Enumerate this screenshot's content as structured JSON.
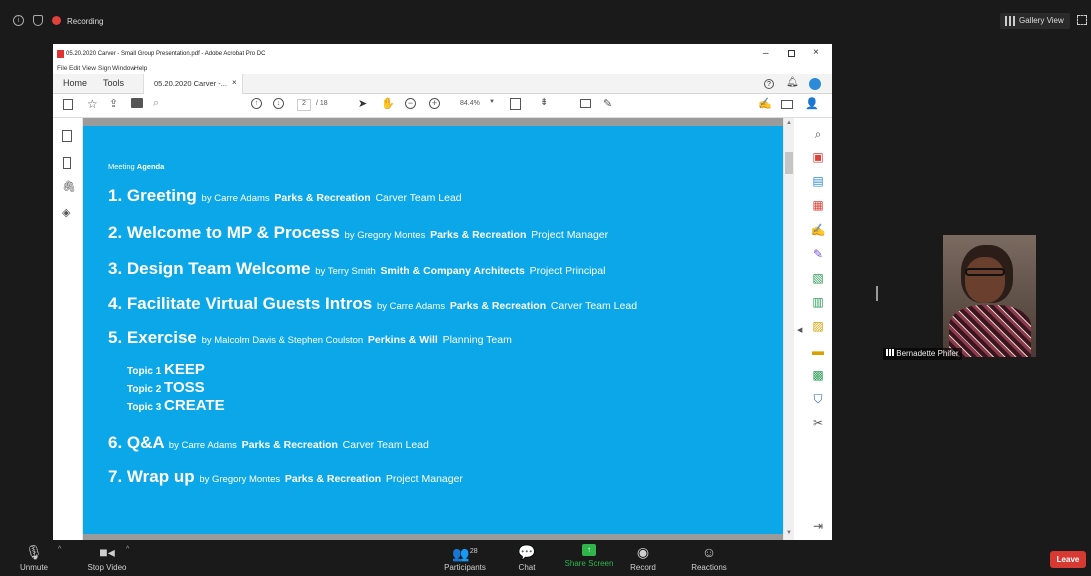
{
  "zoom": {
    "top": {
      "recording_label": "Recording",
      "gallery_view_label": "Gallery View"
    },
    "bottom": {
      "unmute": "Unmute",
      "stop_video": "Stop Video",
      "participants": "Participants",
      "participants_count": "28",
      "chat": "Chat",
      "share_screen": "Share Screen",
      "record": "Record",
      "reactions": "Reactions",
      "leave": "Leave"
    },
    "participant_name": "Bernadette Phifer"
  },
  "acrobat": {
    "window_title": "05.20.2020 Carver - Small Group Presentation.pdf - Adobe Acrobat Pro DC",
    "menu": [
      "File",
      "Edit",
      "View",
      "Sign",
      "Window",
      "Help"
    ],
    "tabs": {
      "home": "Home",
      "tools": "Tools",
      "doc": "05.20.2020 Carver -..."
    },
    "page_current": "2",
    "page_total": "/ 18",
    "zoom_level": "84.4%"
  },
  "slide": {
    "heading_meeting": "Meeting",
    "heading_agenda": "Agenda",
    "items": [
      {
        "title": "1. Greeting",
        "by": "by Carre Adams",
        "org": "Parks & Recreation",
        "role": "Carver Team Lead"
      },
      {
        "title": "2. Welcome to MP & Process",
        "by": "by Gregory Montes",
        "org": "Parks & Recreation",
        "role": "Project Manager"
      },
      {
        "title": "3. Design Team Welcome",
        "by": "by Terry Smith",
        "org": "Smith & Company Architects",
        "role": "Project Principal"
      },
      {
        "title": "4. Facilitate Virtual Guests Intros",
        "by": "by Carre Adams",
        "org": "Parks & Recreation",
        "role": "Carver Team Lead"
      },
      {
        "title": "5. Exercise",
        "by": "by Malcolm Davis & Stephen Coulston",
        "org": "Perkins & Will",
        "role": "Planning Team"
      },
      {
        "title": "6. Q&A",
        "by": "by Carre Adams",
        "org": "Parks & Recreation",
        "role": "Carver Team Lead"
      },
      {
        "title": "7. Wrap up",
        "by": "by Gregory Montes",
        "org": "Parks & Recreation",
        "role": "Project Manager"
      }
    ],
    "topics": [
      {
        "label": "Topic 1",
        "value": "KEEP"
      },
      {
        "label": "Topic 2",
        "value": "TOSS"
      },
      {
        "label": "Topic 3",
        "value": "CREATE"
      }
    ]
  }
}
